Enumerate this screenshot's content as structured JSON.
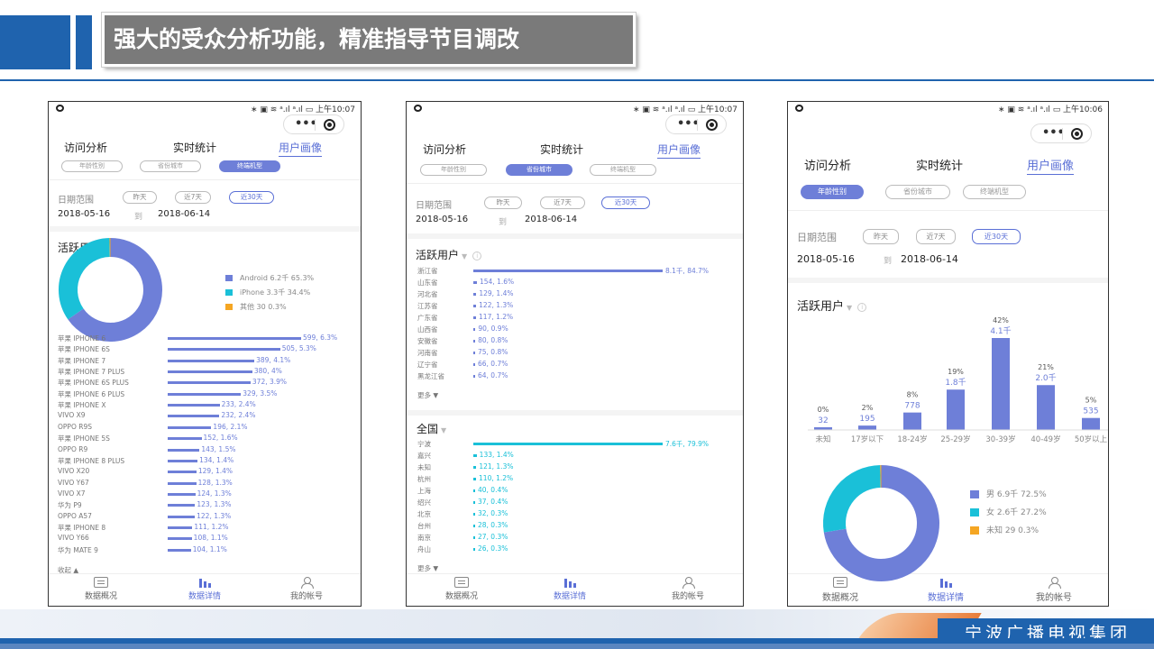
{
  "title": "强大的受众分析功能，精准指导节目调改",
  "footer": "宁波广播电视集团",
  "colors": {
    "blue": "#6e7fd8",
    "cyan": "#1ac0d8",
    "orange": "#f5a623",
    "brand": "#1f63ae"
  },
  "phones": [
    {
      "status_time": "上午10:07",
      "tabs": [
        "访问分析",
        "实时统计",
        "用户画像"
      ],
      "subtabs": [
        "年龄性别",
        "省份城市",
        "终端机型"
      ],
      "active_subtab": 2,
      "date_label": "日期范围",
      "date_opts": [
        "昨天",
        "近7天",
        "近30天"
      ],
      "date_start": "2018-05-16",
      "date_to": "到",
      "date_end": "2018-06-14",
      "section": "活跃用户",
      "legend": [
        "Android 6.2千 65.3%",
        "iPhone 3.3千 34.4%",
        "其他 30 0.3%"
      ],
      "rows": [
        {
          "label": "苹果 IPHONE 6",
          "value": "599, 6.3%",
          "n": 599
        },
        {
          "label": "苹果 IPHONE 6S",
          "value": "505, 5.3%",
          "n": 505
        },
        {
          "label": "苹果 IPHONE 7",
          "value": "389, 4.1%",
          "n": 389
        },
        {
          "label": "苹果 IPHONE 7 PLUS",
          "value": "380, 4%",
          "n": 380
        },
        {
          "label": "苹果 IPHONE 6S PLUS",
          "value": "372, 3.9%",
          "n": 372
        },
        {
          "label": "苹果 IPHONE 6 PLUS",
          "value": "329, 3.5%",
          "n": 329
        },
        {
          "label": "苹果 IPHONE X",
          "value": "233, 2.4%",
          "n": 233
        },
        {
          "label": "VIVO X9",
          "value": "232, 2.4%",
          "n": 232
        },
        {
          "label": "OPPO R9S",
          "value": "196, 2.1%",
          "n": 196
        },
        {
          "label": "苹果 IPHONE 5S",
          "value": "152, 1.6%",
          "n": 152
        },
        {
          "label": "OPPO R9",
          "value": "143, 1.5%",
          "n": 143
        },
        {
          "label": "苹果 IPHONE 8 PLUS",
          "value": "134, 1.4%",
          "n": 134
        },
        {
          "label": "VIVO X20",
          "value": "129, 1.4%",
          "n": 129
        },
        {
          "label": "VIVO Y67",
          "value": "128, 1.3%",
          "n": 128
        },
        {
          "label": "VIVO X7",
          "value": "124, 1.3%",
          "n": 124
        },
        {
          "label": "华为 P9",
          "value": "123, 1.3%",
          "n": 123
        },
        {
          "label": "OPPO A57",
          "value": "122, 1.3%",
          "n": 122
        },
        {
          "label": "苹果 IPHONE 8",
          "value": "111, 1.2%",
          "n": 111
        },
        {
          "label": "VIVO Y66",
          "value": "108, 1.1%",
          "n": 108
        },
        {
          "label": "华为 MATE 9",
          "value": "104, 1.1%",
          "n": 104
        }
      ],
      "collapse": "收起",
      "nav": [
        "数据概况",
        "数据详情",
        "我的帐号"
      ]
    },
    {
      "status_time": "上午10:07",
      "tabs": [
        "访问分析",
        "实时统计",
        "用户画像"
      ],
      "subtabs": [
        "年龄性别",
        "省份城市",
        "终端机型"
      ],
      "active_subtab": 1,
      "date_label": "日期范围",
      "date_opts": [
        "昨天",
        "近7天",
        "近30天"
      ],
      "date_start": "2018-05-16",
      "date_to": "到",
      "date_end": "2018-06-14",
      "section": "活跃用户",
      "provinces": [
        {
          "label": "浙江省",
          "value": "8.1千, 84.7%",
          "n": 8100
        },
        {
          "label": "山东省",
          "value": "154, 1.6%",
          "n": 154
        },
        {
          "label": "河北省",
          "value": "129, 1.4%",
          "n": 129
        },
        {
          "label": "江苏省",
          "value": "122, 1.3%",
          "n": 122
        },
        {
          "label": "广东省",
          "value": "117, 1.2%",
          "n": 117
        },
        {
          "label": "山西省",
          "value": "90, 0.9%",
          "n": 90
        },
        {
          "label": "安徽省",
          "value": "80, 0.8%",
          "n": 80
        },
        {
          "label": "河南省",
          "value": "75, 0.8%",
          "n": 75
        },
        {
          "label": "辽宁省",
          "value": "66, 0.7%",
          "n": 66
        },
        {
          "label": "黑龙江省",
          "value": "64, 0.7%",
          "n": 64
        }
      ],
      "more1": "更多",
      "section2": "全国",
      "cities": [
        {
          "label": "宁波",
          "value": "7.6千, 79.9%",
          "n": 7600
        },
        {
          "label": "嘉兴",
          "value": "133, 1.4%",
          "n": 133
        },
        {
          "label": "未知",
          "value": "121, 1.3%",
          "n": 121
        },
        {
          "label": "杭州",
          "value": "110, 1.2%",
          "n": 110
        },
        {
          "label": "上海",
          "value": "40, 0.4%",
          "n": 40
        },
        {
          "label": "绍兴",
          "value": "37, 0.4%",
          "n": 37
        },
        {
          "label": "北京",
          "value": "32, 0.3%",
          "n": 32
        },
        {
          "label": "台州",
          "value": "28, 0.3%",
          "n": 28
        },
        {
          "label": "南京",
          "value": "27, 0.3%",
          "n": 27
        },
        {
          "label": "舟山",
          "value": "26, 0.3%",
          "n": 26
        }
      ],
      "more2": "更多",
      "nav": [
        "数据概况",
        "数据详情",
        "我的帐号"
      ]
    },
    {
      "status_time": "上午10:06",
      "tabs": [
        "访问分析",
        "实时统计",
        "用户画像"
      ],
      "subtabs": [
        "年龄性别",
        "省份城市",
        "终端机型"
      ],
      "active_subtab": 0,
      "date_label": "日期范围",
      "date_opts": [
        "昨天",
        "近7天",
        "近30天"
      ],
      "date_start": "2018-05-16",
      "date_to": "到",
      "date_end": "2018-06-14",
      "section": "活跃用户",
      "legend": [
        "男 6.9千 72.5%",
        "女 2.6千 27.2%",
        "未知 29 0.3%"
      ],
      "nav": [
        "数据概况",
        "数据详情",
        "我的帐号"
      ]
    }
  ],
  "chart_data": [
    {
      "type": "pie",
      "categories": [
        "Android",
        "iPhone",
        "其他"
      ],
      "values": [
        65.3,
        34.4,
        0.3
      ]
    },
    {
      "type": "bar",
      "categories": [
        "未知",
        "17岁以下",
        "18-24岁",
        "25-29岁",
        "30-39岁",
        "40-49岁",
        "50岁以上"
      ],
      "values": [
        32,
        195,
        778,
        1800,
        4100,
        2000,
        535
      ],
      "value_labels": [
        "32",
        "195",
        "778",
        "1.8千",
        "4.1千",
        "2.0千",
        "535"
      ],
      "pct_labels": [
        "0%",
        "2%",
        "8%",
        "19%",
        "42%",
        "21%",
        "5%"
      ]
    },
    {
      "type": "pie",
      "categories": [
        "男",
        "女",
        "未知"
      ],
      "values": [
        72.5,
        27.2,
        0.3
      ]
    }
  ]
}
